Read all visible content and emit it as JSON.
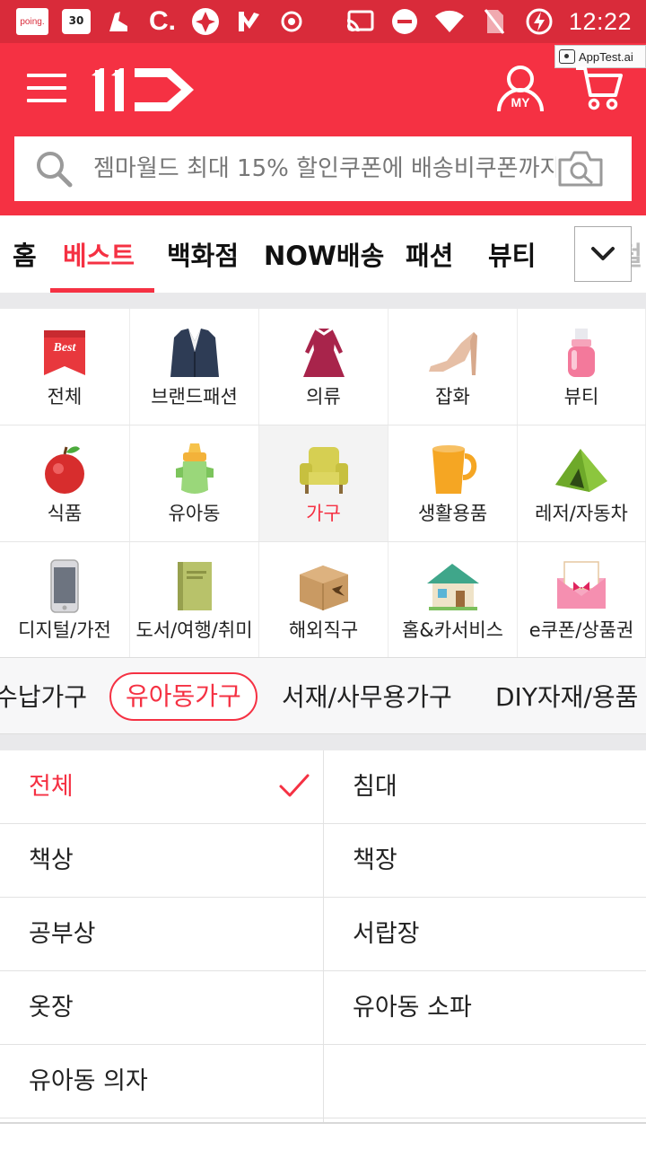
{
  "status_bar": {
    "time": "12:22",
    "notif_badge": "30",
    "poing_label": "poing."
  },
  "header": {
    "logo": "11",
    "my_label": "MY",
    "apptest_label": "AppTest.ai",
    "search_placeholder": "젬마월드 최대 15% 할인쿠폰에 배송비쿠폰까지"
  },
  "tabs": [
    {
      "label": "홈"
    },
    {
      "label": "베스트"
    },
    {
      "label": "백화점"
    },
    {
      "label": "NOW배송"
    },
    {
      "label": "패션"
    },
    {
      "label": "뷰티"
    },
    {
      "label": "디지털"
    }
  ],
  "categories": [
    {
      "label": "전체",
      "icon": "best-ribbon-icon",
      "badge": "Best"
    },
    {
      "label": "브랜드패션",
      "icon": "suit-jacket-icon"
    },
    {
      "label": "의류",
      "icon": "dress-icon"
    },
    {
      "label": "잡화",
      "icon": "high-heel-icon"
    },
    {
      "label": "뷰티",
      "icon": "cosmetic-bottle-icon"
    },
    {
      "label": "식품",
      "icon": "apple-icon"
    },
    {
      "label": "유아동",
      "icon": "baby-bottle-icon"
    },
    {
      "label": "가구",
      "icon": "armchair-icon"
    },
    {
      "label": "생활용품",
      "icon": "mug-icon"
    },
    {
      "label": "레저/자동차",
      "icon": "tent-icon"
    },
    {
      "label": "디지털/가전",
      "icon": "smartphone-icon"
    },
    {
      "label": "도서/여행/취미",
      "icon": "book-icon"
    },
    {
      "label": "해외직구",
      "icon": "parcel-box-icon"
    },
    {
      "label": "홈&카서비스",
      "icon": "house-icon"
    },
    {
      "label": "e쿠폰/상품권",
      "icon": "gift-envelope-icon"
    }
  ],
  "selected_category": "가구",
  "subcategories": [
    {
      "label": "수납가구"
    },
    {
      "label": "유아동가구"
    },
    {
      "label": "서재/사무용가구"
    },
    {
      "label": "DIY자재/용품"
    }
  ],
  "selected_subcategory": "유아동가구",
  "sub_items": [
    {
      "left": "전체",
      "right": "침대"
    },
    {
      "left": "책상",
      "right": "책장"
    },
    {
      "left": "공부상",
      "right": "서랍장"
    },
    {
      "left": "옷장",
      "right": "유아동 소파"
    },
    {
      "left": "유아동 의자",
      "right": ""
    }
  ],
  "colors": {
    "brand_red": "#f53143",
    "status_bar": "#d92b3a"
  }
}
